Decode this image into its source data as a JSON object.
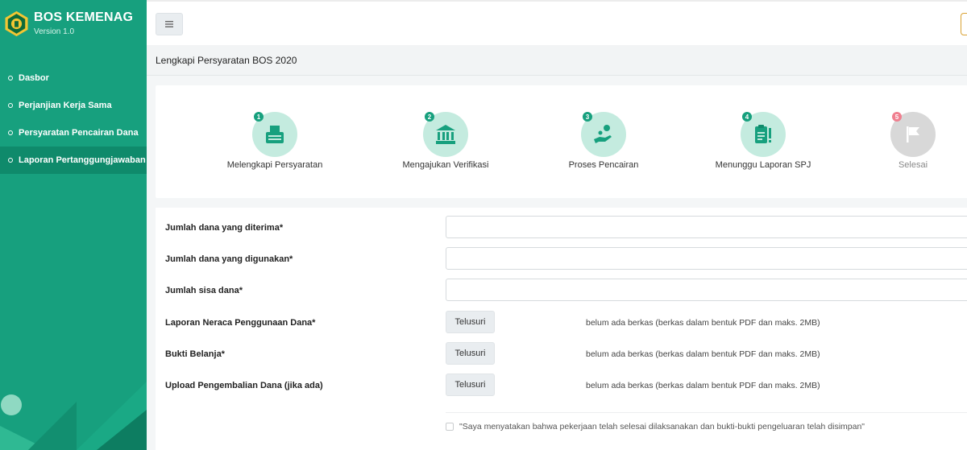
{
  "app": {
    "title": "BOS KEMENAG",
    "version": "Version 1.0"
  },
  "sidebar": {
    "items": [
      {
        "label": "Dasbor",
        "active": false
      },
      {
        "label": "Perjanjian Kerja Sama",
        "active": false
      },
      {
        "label": "Persyaratan Pencairan Dana",
        "active": false
      },
      {
        "label": "Laporan Pertanggungjawaban",
        "active": true
      }
    ]
  },
  "header": {
    "menu_icon": "hamburger-icon"
  },
  "page": {
    "title": "Lengkapi Persyaratan BOS 2020"
  },
  "steps": [
    {
      "number": "1",
      "label": "Melengkapi Persyaratan",
      "icon": "typewriter-icon",
      "state": "done"
    },
    {
      "number": "2",
      "label": "Mengajukan Verifikasi",
      "icon": "bank-icon",
      "state": "done"
    },
    {
      "number": "3",
      "label": "Proses Pencairan",
      "icon": "hand-coin-icon",
      "state": "done"
    },
    {
      "number": "4",
      "label": "Menunggu Laporan SPJ",
      "icon": "clipboard-alert-icon",
      "state": "current"
    },
    {
      "number": "5",
      "label": "Selesai",
      "icon": "flag-icon",
      "state": "pending"
    }
  ],
  "form": {
    "fields": [
      {
        "label": "Jumlah dana yang diterima*",
        "value": ""
      },
      {
        "label": "Jumlah dana yang digunakan*",
        "value": ""
      },
      {
        "label": "Jumlah sisa dana*",
        "value": ""
      }
    ],
    "uploads": [
      {
        "label": "Laporan Neraca Penggunaan Dana*",
        "button": "Telusuri",
        "note": "belum ada berkas (berkas dalam bentuk PDF dan maks. 2MB)"
      },
      {
        "label": "Bukti Belanja*",
        "button": "Telusuri",
        "note": "belum ada berkas (berkas dalam bentuk PDF dan maks. 2MB)"
      },
      {
        "label": "Upload Pengembalian Dana (jika ada)",
        "button": "Telusuri",
        "note": "belum ada berkas (berkas dalam bentuk PDF dan maks. 2MB)"
      }
    ],
    "agreement": "\"Saya menyatakan bahwa pekerjaan telah selesai dilaksanakan dan bukti-bukti pengeluaran telah disimpan\""
  },
  "colors": {
    "primary": "#17a07e",
    "primary_dark": "#0f8a6b",
    "step_bg": "#bfe9dc",
    "pending_badge": "#f07f8f"
  }
}
